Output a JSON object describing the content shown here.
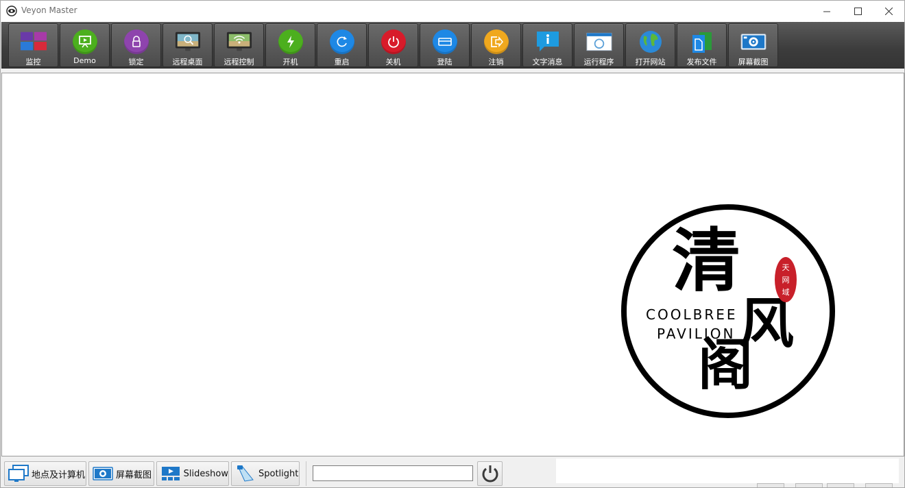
{
  "window": {
    "title": "Veyon Master"
  },
  "toolbar": {
    "items": [
      {
        "label": "监控",
        "icon": "monitor-grid-icon"
      },
      {
        "label": "Demo",
        "icon": "demo-presentation-icon"
      },
      {
        "label": "锁定",
        "icon": "lock-icon"
      },
      {
        "label": "远程桌面",
        "icon": "remote-view-icon"
      },
      {
        "label": "远程控制",
        "icon": "remote-control-icon"
      },
      {
        "label": "开机",
        "icon": "power-on-icon"
      },
      {
        "label": "重启",
        "icon": "reboot-icon"
      },
      {
        "label": "关机",
        "icon": "power-off-icon"
      },
      {
        "label": "登陆",
        "icon": "logon-icon"
      },
      {
        "label": "注销",
        "icon": "logout-icon"
      },
      {
        "label": "文字消息",
        "icon": "text-message-icon"
      },
      {
        "label": "运行程序",
        "icon": "run-program-icon"
      },
      {
        "label": "打开网站",
        "icon": "open-website-icon"
      },
      {
        "label": "发布文件",
        "icon": "transfer-file-icon"
      },
      {
        "label": "屏幕截图",
        "icon": "screenshot-icon"
      }
    ]
  },
  "watermark": {
    "char1": "清",
    "char2": "风",
    "char3": "阁",
    "line1": "COOLBREE",
    "line2": "PAVILION",
    "seal": [
      "天",
      "网",
      "域"
    ]
  },
  "bottombar": {
    "buttons": [
      {
        "label": "地点及计算机",
        "icon": "computers-icon"
      },
      {
        "label": "屏幕截图",
        "icon": "screenshot-icon"
      },
      {
        "label": "Slideshow",
        "icon": "slideshow-icon"
      },
      {
        "label": "Spotlight",
        "icon": "spotlight-icon"
      }
    ],
    "search_value": ""
  },
  "colors": {
    "toolbar_bg": "#3c3c3c",
    "monitor_tiles": [
      "#6a3aa8",
      "#a83aa8",
      "#2a7ad8",
      "#d82a3a"
    ],
    "demo": "#4caf1e",
    "lock": "#8e44ad",
    "power_on": "#4caf1e",
    "reboot": "#1e88e5",
    "power_off": "#d81b2a",
    "logon": "#1e88e5",
    "logout": "#f0a81e",
    "seal_red": "#c8202a"
  }
}
